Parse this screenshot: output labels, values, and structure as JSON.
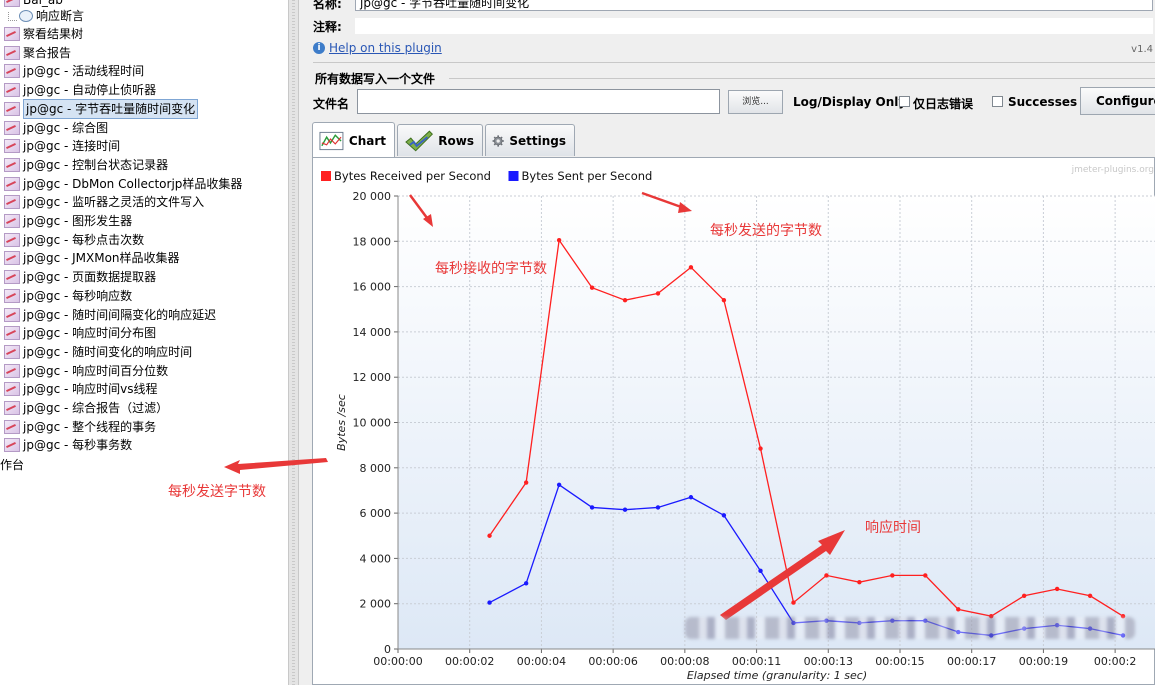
{
  "tree": {
    "top_partial": "Bai_ab",
    "assertion_item": "响应断言",
    "items": [
      "察看结果树",
      "聚合报告",
      "jp@gc - 活动线程时间",
      "jp@gc - 自动停止侦听器",
      "jp@gc - 字节吞吐量随时间变化",
      "jp@gc - 综合图",
      "jp@gc - 连接时间",
      "jp@gc - 控制台状态记录器",
      "jp@gc - DbMon Collectorjp样品收集器",
      "jp@gc - 监听器之灵活的文件写入",
      "jp@gc - 图形发生器",
      "jp@gc - 每秒点击次数",
      "jp@gc - JMXMon样品收集器",
      "jp@gc - 页面数据提取器",
      "jp@gc - 每秒响应数",
      "jp@gc - 随时间间隔变化的响应延迟",
      "jp@gc - 响应时间分布图",
      "jp@gc - 随时间变化的响应时间",
      "jp@gc - 响应时间百分位数",
      "jp@gc - 响应时间vs线程",
      "jp@gc - 综合报告（过滤）",
      "jp@gc - 整个线程的事务",
      "jp@gc - 每秒事务数"
    ],
    "selected_index": 4,
    "console_partial": "作台"
  },
  "form": {
    "name_label": "名称:",
    "name_value": "jp@gc - 字节吞吐量随时间变化",
    "comment_label": "注释:",
    "help_link": "Help on this plugin",
    "version": "v1.4",
    "file_group_title": "所有数据写入一个文件",
    "file_label": "文件名",
    "browse_button": "浏览...",
    "log_display_label": "Log/Display Only:",
    "errors_only_label": "仅日志错误",
    "successes_label": "Successes",
    "configure_button": "Configure"
  },
  "tabs": [
    {
      "label": "Chart",
      "icon": "chart-icon",
      "active": true
    },
    {
      "label": "Rows",
      "icon": "checkmark-icon",
      "active": false
    },
    {
      "label": "Settings",
      "icon": "gear-icon",
      "active": false
    }
  ],
  "annotations": {
    "received": "每秒接收的字节数",
    "sent_top": "每秒发送的字节数",
    "sent_left": "每秒发送字节数",
    "response_time": "响应时间"
  },
  "colors": {
    "received": "#ff2020",
    "sent": "#1a1aff",
    "annotation": "#e83838"
  },
  "chart_data": {
    "type": "line",
    "watermark": "jmeter-plugins.org",
    "ylabel": "Bytes /sec",
    "xlabel": "Elapsed time (granularity: 1 sec)",
    "ylim": [
      0,
      20000
    ],
    "yticks": [
      "0",
      "2 000",
      "4 000",
      "6 000",
      "8 000",
      "10 000",
      "12 000",
      "14 000",
      "16 000",
      "18 000",
      "20 000"
    ],
    "xticks": [
      "00:00:00",
      "00:00:02",
      "00:00:04",
      "00:00:06",
      "00:00:08",
      "00:00:11",
      "00:00:13",
      "00:00:15",
      "00:00:17",
      "00:00:19",
      "00:00:2"
    ],
    "grid": true,
    "legend": "top-left",
    "series": [
      {
        "name": "Bytes Received per Second",
        "x": [
          2.5,
          3.5,
          4.4,
          5.3,
          6.2,
          7.1,
          8.0,
          8.9,
          9.9,
          10.8,
          11.7,
          12.6,
          13.5,
          14.4,
          15.3,
          16.2,
          17.1,
          18.0,
          18.9,
          19.8
        ],
        "values": [
          5000,
          7350,
          18050,
          15950,
          15400,
          15700,
          16850,
          15400,
          8850,
          2050,
          3250,
          2950,
          3250,
          3250,
          1750,
          1450,
          2350,
          2650,
          2350,
          1450
        ]
      },
      {
        "name": "Bytes Sent per Second",
        "x": [
          2.5,
          3.5,
          4.4,
          5.3,
          6.2,
          7.1,
          8.0,
          8.9,
          9.9,
          10.8,
          11.7,
          12.6,
          13.5,
          14.4,
          15.3,
          16.2,
          17.1,
          18.0,
          18.9,
          19.8
        ],
        "values": [
          2050,
          2900,
          7250,
          6250,
          6150,
          6250,
          6700,
          5900,
          3450,
          1150,
          1250,
          1150,
          1250,
          1250,
          750,
          600,
          900,
          1050,
          900,
          600
        ]
      }
    ]
  }
}
